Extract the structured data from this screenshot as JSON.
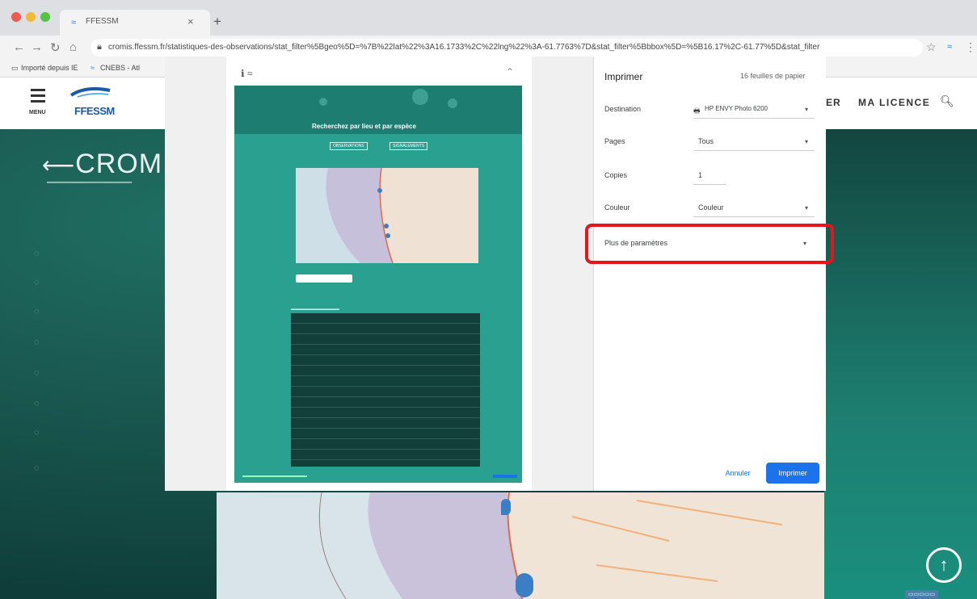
{
  "browser": {
    "tab_title": "FFESSM",
    "url": "cromis.ffessm.fr/statistiques-des-observations/stat_filter%5Bgeo%5D=%7B%22lat%22%3A16.1733%2C%22lng%22%3A-61.7763%7D&stat_filter%5Bbbox%5D=%5B16.17%2C-61.77%5D&stat_filter",
    "bookmarks": [
      "Importé depuis IE",
      "CNEBS - Atl"
    ]
  },
  "site": {
    "menu_label": "MENU",
    "logo_text": "FFESSM",
    "nav_partial": "ER",
    "nav_licence": "MA LICENCE",
    "brand": "CROMIS"
  },
  "print_dialog": {
    "title": "Imprimer",
    "sheets": "16 feuilles de papier",
    "destination_label": "Destination",
    "destination_value": "HP ENVY Photo 6200",
    "pages_label": "Pages",
    "pages_value": "Tous",
    "copies_label": "Copies",
    "copies_value": "1",
    "color_label": "Couleur",
    "color_value": "Couleur",
    "more_settings": "Plus de paramètres",
    "cancel": "Annuler",
    "print": "Imprimer"
  },
  "preview": {
    "sheet_title": "Recherchez par lieu et par espèce",
    "sheet_btn_a": "OBSERVATIONS",
    "sheet_btn_b": "SIGNALEMENTS"
  },
  "colors": {
    "highlight": "#e8141c",
    "primary": "#1a73e8",
    "teal": "#2aa091"
  }
}
